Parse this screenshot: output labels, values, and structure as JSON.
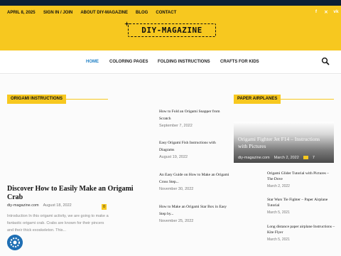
{
  "topbar": {
    "date": "APRIL 8, 2025",
    "links": [
      "SIGN IN / JOIN",
      "ABOUT DIY-MAGAZINE",
      "BLOG",
      "CONTACT"
    ],
    "socials": [
      {
        "icon": "facebook-icon",
        "glyph": "f"
      },
      {
        "icon": "x-twitter-icon",
        "glyph": "✕"
      },
      {
        "icon": "vk-icon",
        "glyph": "vk"
      }
    ]
  },
  "logo": {
    "text": "DIY-MAGAZINE"
  },
  "nav": {
    "items": [
      "HOME",
      "COLORING PAGES",
      "FOLDING INSTRUCTIONS",
      "CRAFTS FOR KIDS"
    ],
    "active": "HOME",
    "search_icon": "search-icon"
  },
  "colors": {
    "accent": "#f7c81f",
    "nav_active": "#1f7fc4",
    "top_strip": "#0c2035"
  },
  "sections": {
    "left": "ORIGAMI INSTRUCTIONS",
    "right": "PAPER AIRPLANES"
  },
  "featured": {
    "title": "Discover How to Easily Make an Origami Crab",
    "author": "diy-magazine.com",
    "date": "August 18, 2022",
    "comment_count": "0",
    "excerpt": "Introduction In this origami activity, we are going to make a fantastic origami crab. Crabs are known for their pincers and their thick exoskeleton. This..."
  },
  "mid_list": [
    {
      "title": "How to Fold an Origami Snapper from Scratch",
      "date": "September 7, 2022"
    },
    {
      "title": "Easy Origami Fish Instructions with Diagrams",
      "date": "August 19, 2022"
    },
    {
      "title": "An Easy Guide on How to Make an Origami Cross Step...",
      "date": "November 30, 2022"
    },
    {
      "title": "How to Make an Origami Star Box in Easy Step by...",
      "date": "November 25, 2022"
    }
  ],
  "hero": {
    "title": "Origami Fighter Jet F14 – Instructions with Pictures",
    "author": "diy-magazine.com",
    "date": "March 2, 2022",
    "count": "7"
  },
  "side_list": [
    {
      "title": "Origami Glider Tutorial with Pictures – The Dove",
      "date": "March 2, 2022"
    },
    {
      "title": "Star Wars Tie Fighter – Paper Airplane Tutorial",
      "date": "March 5, 2021"
    },
    {
      "title": "Long distance paper airplane Instructions – Kite Flyer",
      "date": "March 5, 2021"
    }
  ]
}
